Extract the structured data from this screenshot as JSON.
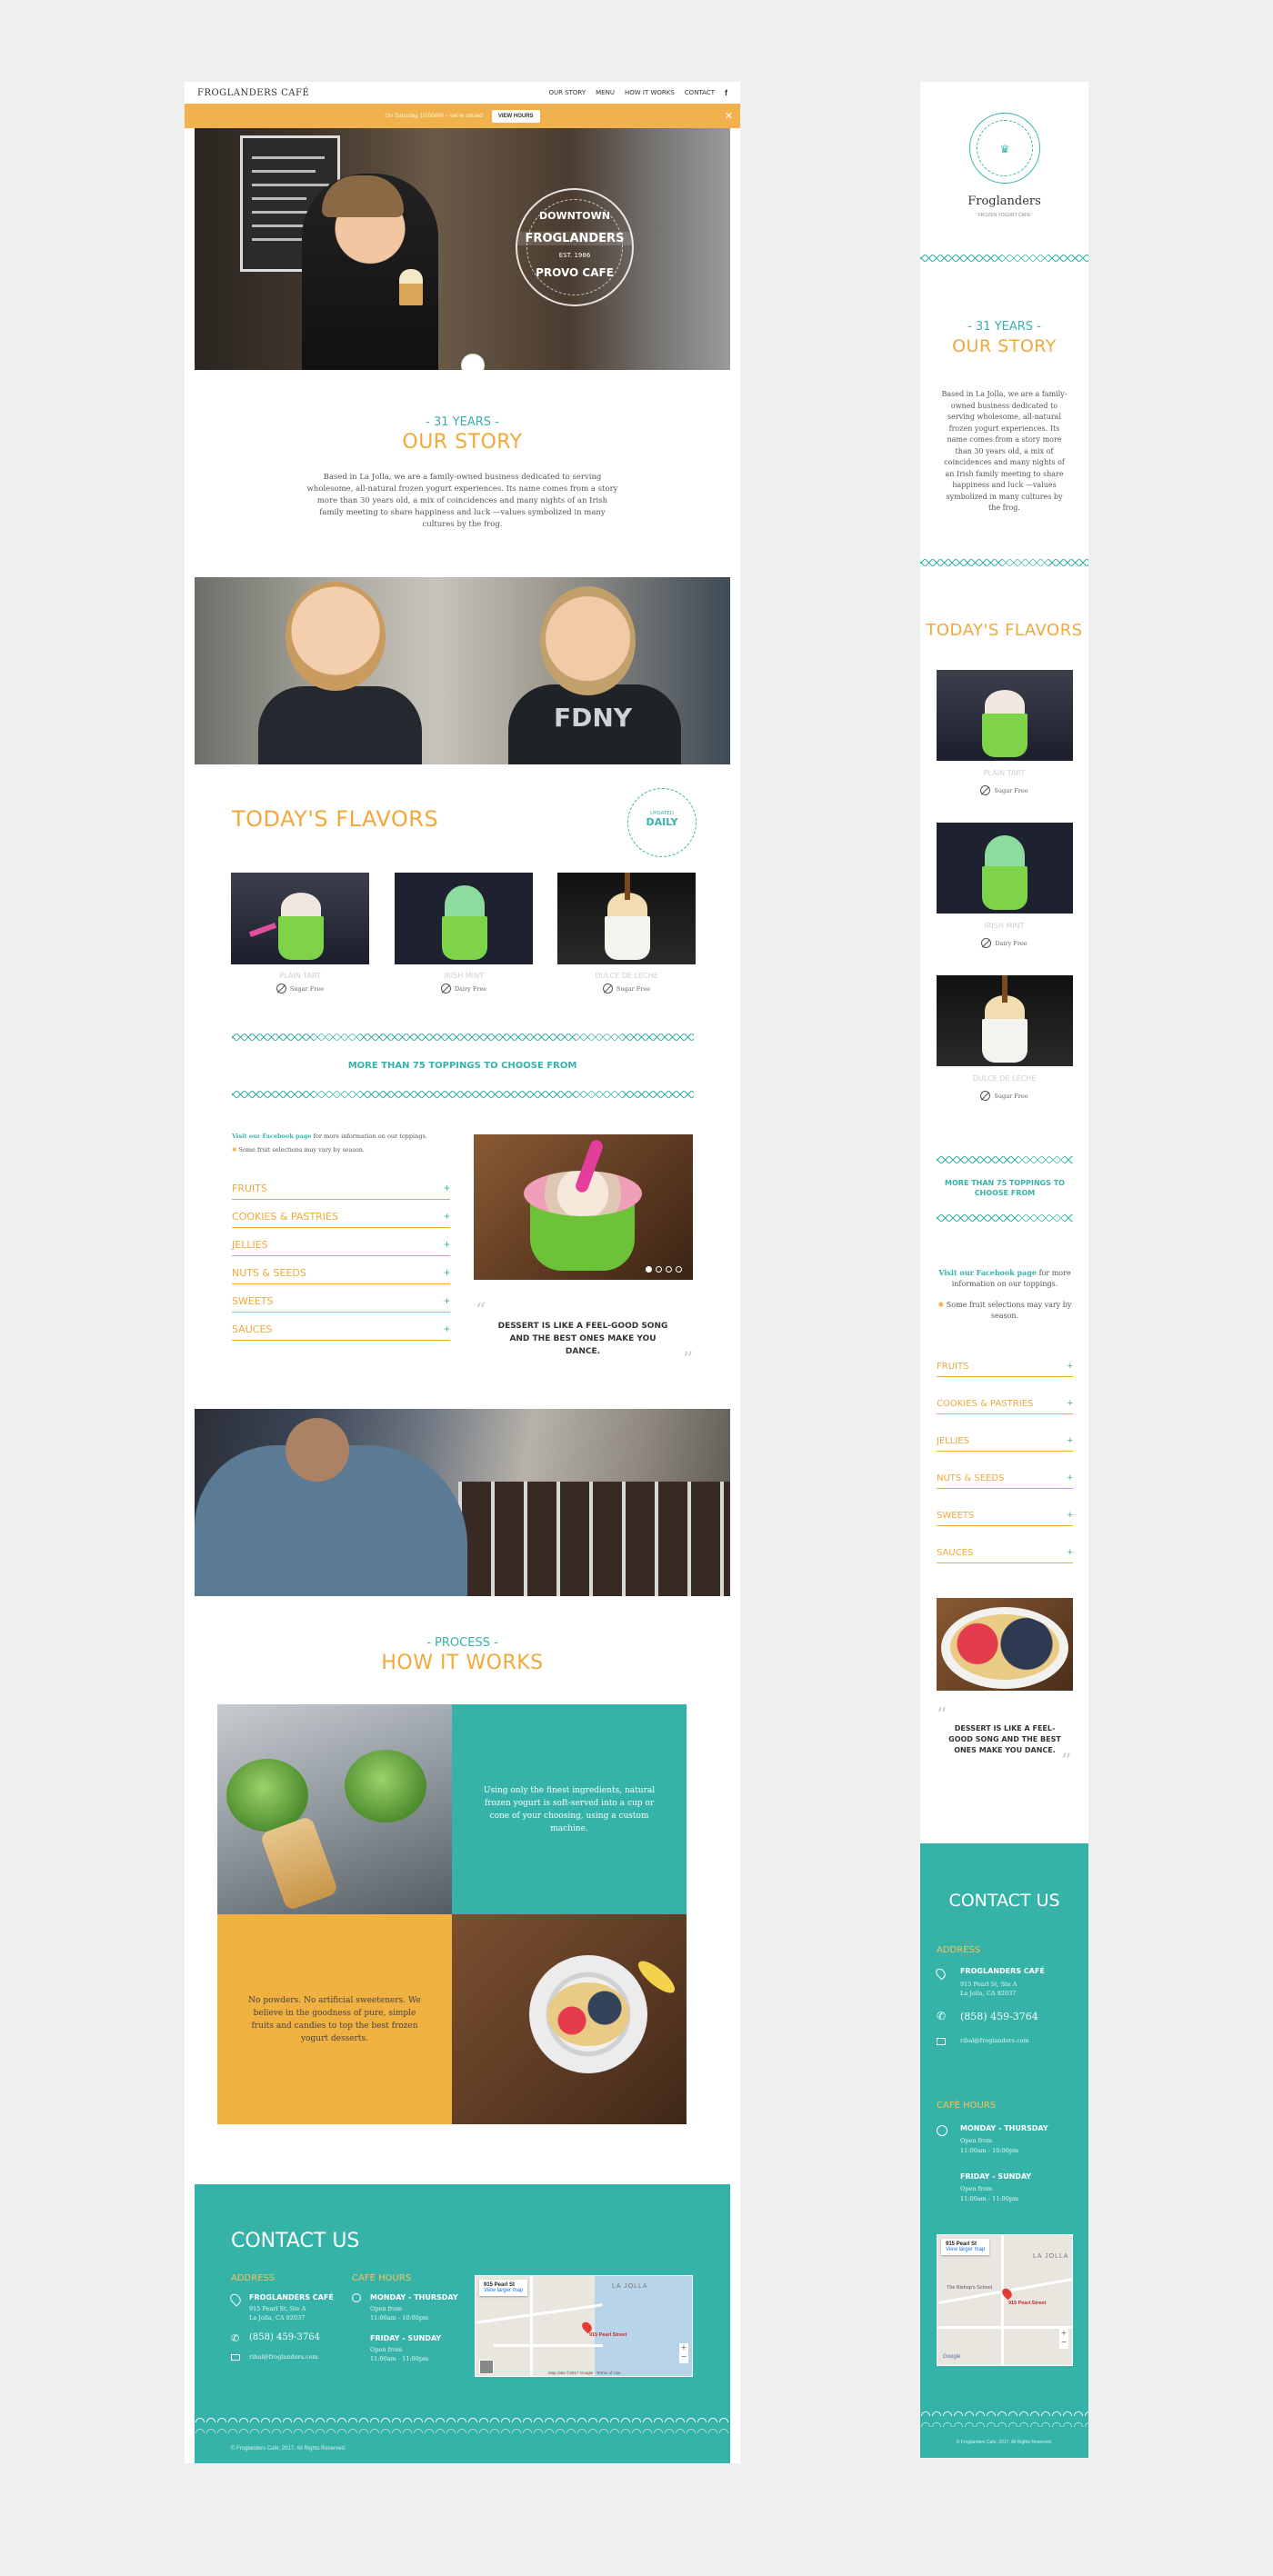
{
  "brand": {
    "name": "FROGLANDERS CAFÉ",
    "logo_name": "Froglanders",
    "logo_tag": "FROZEN YOGURT CAFE",
    "emblem_top": "DOWNTOWN",
    "emblem_mid": "FROGLANDERS",
    "emblem_est": "EST. 1986",
    "emblem_bottom": "PROVO CAFE"
  },
  "nav": {
    "links": [
      "OUR STORY",
      "MENU",
      "HOW IT WORKS",
      "CONTACT"
    ],
    "social_icon": "facebook-icon"
  },
  "banner": {
    "message": "On Saturday 10:00AM – we're closed",
    "button": "VIEW HOURS",
    "close": "✕"
  },
  "story": {
    "eyebrow": "- 31 YEARS -",
    "title": "OUR STORY",
    "body": "Based in La Jolla, we are a family-owned business dedicated to serving wholesome, all-natural frozen yogurt experiences. Its name comes from a story more than 30 years old, a mix of coincidences and many nights of an Irish family meeting to share happiness and luck —values symbolized in many cultures by the frog."
  },
  "flavors": {
    "title": "TODAY'S FLAVORS",
    "stamp_top": "UPDATED",
    "stamp_main": "DAILY",
    "items": [
      {
        "name": "PLAIN TART",
        "tag": "Sugar Free",
        "icon": "no-sugar-icon",
        "swirl": "#f1e6e0"
      },
      {
        "name": "IRISH MINT",
        "tag": "Dairy Free",
        "icon": "no-dairy-icon",
        "swirl": "#8edb9e"
      },
      {
        "name": "DULCE DE LECHE",
        "tag": "Sugar Free",
        "icon": "no-sugar-icon",
        "swirl": "#f1ddb0"
      }
    ]
  },
  "toppings": {
    "heading": "MORE THAN 75 TOPPINGS TO CHOOSE FROM",
    "facebook_link": "Visit our Facebook page",
    "facebook_rest": " for more information on our toppings.",
    "note": "Some fruit selections may vary by season.",
    "categories": [
      "FRUITS",
      "COOKIES & PASTRIES",
      "JELLIES",
      "NUTS & SEEDS",
      "SWEETS",
      "SAUCES"
    ],
    "expand_symbol": "+",
    "quote": "DESSERT IS LIKE A FEEL-GOOD SONG AND THE BEST ONES MAKE YOU DANCE.",
    "quote_open": "“",
    "quote_close": "”"
  },
  "process": {
    "eyebrow": "- PROCESS -",
    "title": "HOW IT WORKS",
    "text1": "Using only the finest ingredients, natural frozen yogurt is soft-served into a cup or cone of your choosing, using a custom machine.",
    "text2": "No powders. No artificial sweeteners. We believe in the goodness of pure, simple fruits and candies to top the best frozen yogurt desserts."
  },
  "contact": {
    "title": "CONTACT US",
    "address_label": "ADDRESS",
    "place": "FROGLANDERS CAFÉ",
    "street": "915 Pearl St, Ste A",
    "city": "La Jolla, CA 92037",
    "phone": "(858) 459-3764",
    "email": "ribal@froglanders.com",
    "hours_label": "CAFÉ HOURS",
    "days1": "MONDAY - THURSDAY",
    "open1": "Open from",
    "time1": "11:00am - 10:00pm",
    "days2": "FRIDAY - SUNDAY",
    "open2": "Open from",
    "time2": "11:00am - 11:00pm",
    "map_title": "915 Pearl St",
    "map_link": "View larger map",
    "map_pin": "915 Pearl Street",
    "map_area": "LA JOLLA",
    "map_school": "The Bishop's School",
    "map_google": "Google",
    "map_footer": "Map data ©2017 Google · Terms of Use"
  },
  "copyright": "© Froglanders Cafe, 2017. All Rights Reserved."
}
